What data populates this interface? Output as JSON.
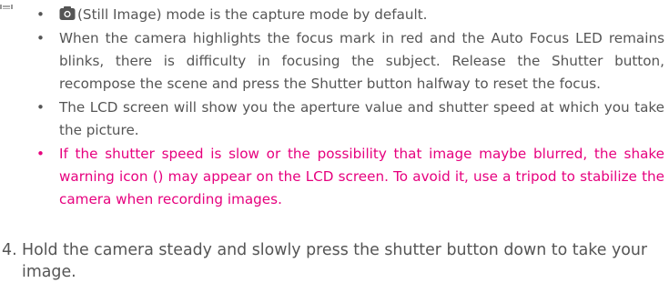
{
  "icons": {
    "note": "note-icon",
    "still_image_mode": "camera-icon"
  },
  "colors": {
    "text": "#555555",
    "highlight": "#e6007e"
  },
  "bullets": [
    {
      "text": "(Still Image) mode is the capture mode by default.",
      "highlight": false
    },
    {
      "text": "When the camera highlights the focus mark in red and the Auto Focus LED remains blinks, there is difficulty in focusing the subject. Release the Shutter button, recompose the scene and press the Shutter button halfway to reset the focus.",
      "highlight": false
    },
    {
      "text": "The LCD screen will show you the aperture value and shutter speed at which you take the picture.",
      "highlight": false
    },
    {
      "text": "If the shutter speed is slow or the possibility that image maybe blurred, the shake warning icon () may appear on the LCD screen. To avoid it, use a tripod to stabilize the camera when recording images.",
      "highlight": true
    }
  ],
  "step": {
    "number": "4.",
    "text": "Hold the camera steady and slowly press the shutter button down to take your image."
  }
}
